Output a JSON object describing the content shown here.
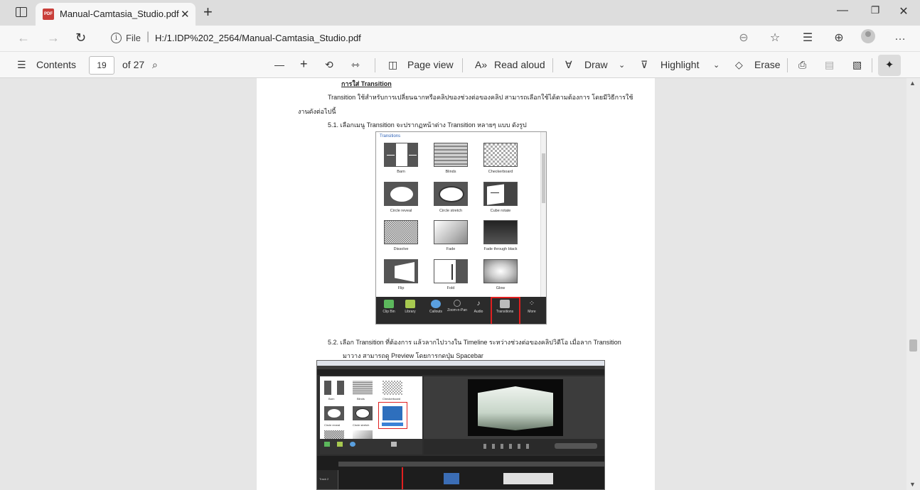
{
  "browser": {
    "tab_title": "Manual-Camtasia_Studio.pdf",
    "url_scheme_label": "File",
    "url": "H:/1.IDP%202_2564/Manual-Camtasia_Studio.pdf"
  },
  "pdf_toolbar": {
    "contents_label": "Contents",
    "current_page": "19",
    "page_total": "of 27",
    "page_view_label": "Page view",
    "read_aloud_label": "Read aloud",
    "draw_label": "Draw",
    "highlight_label": "Highlight",
    "erase_label": "Erase"
  },
  "document": {
    "heading": "การใส่ Transition",
    "para1_line1": "Transition ใช้สำหรับการเปลี่ยนฉากหรือคลิปของช่วงต่อของคลิป สามารถเลือกใช้ได้ตามต้องการ โดยมีวิธีการใช้",
    "para1_line2": "งานดังต่อไปนี้",
    "step1": "5.1.  เลือกเมนู Transition จะปรากฏหน้าต่าง Transition หลายๆ แบบ ดังรูป",
    "step2_line1": "5.2.  เลือก Transition ที่ต้องการ แล้วลากไปวางใน Timeline ระหว่างช่วงต่อของคลิปวิดีโอ เมื่อลาก Transition",
    "step2_line2": "มาวาง สามารถดู Preview โดยการกดปุ่ม Spacebar"
  },
  "transitions_panel": {
    "title": "Transitions",
    "items": [
      "Barn",
      "Blinds",
      "Checkerboard",
      "Circle reveal",
      "Circle stretch",
      "Cube rotate",
      "Dissolve",
      "Fade",
      "Fade through black",
      "Flip",
      "Fold",
      "Glow"
    ],
    "dock": [
      "Clip Bin",
      "Library",
      "Callouts",
      "Zoom-n-Pan",
      "Audio",
      "Transitions",
      "More"
    ]
  },
  "camtasia_shot": {
    "lib_items": [
      "Barn",
      "Blinds",
      "Checkerboard",
      "Circle reveal",
      "Circle stretch",
      "Cube rotate"
    ],
    "track_label": "Track 2"
  }
}
